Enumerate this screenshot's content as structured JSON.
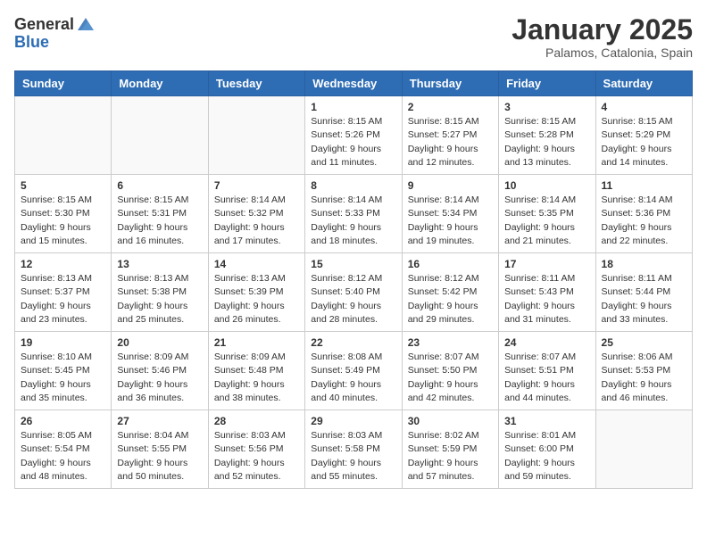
{
  "header": {
    "logo_general": "General",
    "logo_blue": "Blue",
    "month_title": "January 2025",
    "location": "Palamos, Catalonia, Spain"
  },
  "days_of_week": [
    "Sunday",
    "Monday",
    "Tuesday",
    "Wednesday",
    "Thursday",
    "Friday",
    "Saturday"
  ],
  "weeks": [
    [
      {
        "day": "",
        "info": ""
      },
      {
        "day": "",
        "info": ""
      },
      {
        "day": "",
        "info": ""
      },
      {
        "day": "1",
        "info": "Sunrise: 8:15 AM\nSunset: 5:26 PM\nDaylight: 9 hours\nand 11 minutes."
      },
      {
        "day": "2",
        "info": "Sunrise: 8:15 AM\nSunset: 5:27 PM\nDaylight: 9 hours\nand 12 minutes."
      },
      {
        "day": "3",
        "info": "Sunrise: 8:15 AM\nSunset: 5:28 PM\nDaylight: 9 hours\nand 13 minutes."
      },
      {
        "day": "4",
        "info": "Sunrise: 8:15 AM\nSunset: 5:29 PM\nDaylight: 9 hours\nand 14 minutes."
      }
    ],
    [
      {
        "day": "5",
        "info": "Sunrise: 8:15 AM\nSunset: 5:30 PM\nDaylight: 9 hours\nand 15 minutes."
      },
      {
        "day": "6",
        "info": "Sunrise: 8:15 AM\nSunset: 5:31 PM\nDaylight: 9 hours\nand 16 minutes."
      },
      {
        "day": "7",
        "info": "Sunrise: 8:14 AM\nSunset: 5:32 PM\nDaylight: 9 hours\nand 17 minutes."
      },
      {
        "day": "8",
        "info": "Sunrise: 8:14 AM\nSunset: 5:33 PM\nDaylight: 9 hours\nand 18 minutes."
      },
      {
        "day": "9",
        "info": "Sunrise: 8:14 AM\nSunset: 5:34 PM\nDaylight: 9 hours\nand 19 minutes."
      },
      {
        "day": "10",
        "info": "Sunrise: 8:14 AM\nSunset: 5:35 PM\nDaylight: 9 hours\nand 21 minutes."
      },
      {
        "day": "11",
        "info": "Sunrise: 8:14 AM\nSunset: 5:36 PM\nDaylight: 9 hours\nand 22 minutes."
      }
    ],
    [
      {
        "day": "12",
        "info": "Sunrise: 8:13 AM\nSunset: 5:37 PM\nDaylight: 9 hours\nand 23 minutes."
      },
      {
        "day": "13",
        "info": "Sunrise: 8:13 AM\nSunset: 5:38 PM\nDaylight: 9 hours\nand 25 minutes."
      },
      {
        "day": "14",
        "info": "Sunrise: 8:13 AM\nSunset: 5:39 PM\nDaylight: 9 hours\nand 26 minutes."
      },
      {
        "day": "15",
        "info": "Sunrise: 8:12 AM\nSunset: 5:40 PM\nDaylight: 9 hours\nand 28 minutes."
      },
      {
        "day": "16",
        "info": "Sunrise: 8:12 AM\nSunset: 5:42 PM\nDaylight: 9 hours\nand 29 minutes."
      },
      {
        "day": "17",
        "info": "Sunrise: 8:11 AM\nSunset: 5:43 PM\nDaylight: 9 hours\nand 31 minutes."
      },
      {
        "day": "18",
        "info": "Sunrise: 8:11 AM\nSunset: 5:44 PM\nDaylight: 9 hours\nand 33 minutes."
      }
    ],
    [
      {
        "day": "19",
        "info": "Sunrise: 8:10 AM\nSunset: 5:45 PM\nDaylight: 9 hours\nand 35 minutes."
      },
      {
        "day": "20",
        "info": "Sunrise: 8:09 AM\nSunset: 5:46 PM\nDaylight: 9 hours\nand 36 minutes."
      },
      {
        "day": "21",
        "info": "Sunrise: 8:09 AM\nSunset: 5:48 PM\nDaylight: 9 hours\nand 38 minutes."
      },
      {
        "day": "22",
        "info": "Sunrise: 8:08 AM\nSunset: 5:49 PM\nDaylight: 9 hours\nand 40 minutes."
      },
      {
        "day": "23",
        "info": "Sunrise: 8:07 AM\nSunset: 5:50 PM\nDaylight: 9 hours\nand 42 minutes."
      },
      {
        "day": "24",
        "info": "Sunrise: 8:07 AM\nSunset: 5:51 PM\nDaylight: 9 hours\nand 44 minutes."
      },
      {
        "day": "25",
        "info": "Sunrise: 8:06 AM\nSunset: 5:53 PM\nDaylight: 9 hours\nand 46 minutes."
      }
    ],
    [
      {
        "day": "26",
        "info": "Sunrise: 8:05 AM\nSunset: 5:54 PM\nDaylight: 9 hours\nand 48 minutes."
      },
      {
        "day": "27",
        "info": "Sunrise: 8:04 AM\nSunset: 5:55 PM\nDaylight: 9 hours\nand 50 minutes."
      },
      {
        "day": "28",
        "info": "Sunrise: 8:03 AM\nSunset: 5:56 PM\nDaylight: 9 hours\nand 52 minutes."
      },
      {
        "day": "29",
        "info": "Sunrise: 8:03 AM\nSunset: 5:58 PM\nDaylight: 9 hours\nand 55 minutes."
      },
      {
        "day": "30",
        "info": "Sunrise: 8:02 AM\nSunset: 5:59 PM\nDaylight: 9 hours\nand 57 minutes."
      },
      {
        "day": "31",
        "info": "Sunrise: 8:01 AM\nSunset: 6:00 PM\nDaylight: 9 hours\nand 59 minutes."
      },
      {
        "day": "",
        "info": ""
      }
    ]
  ]
}
